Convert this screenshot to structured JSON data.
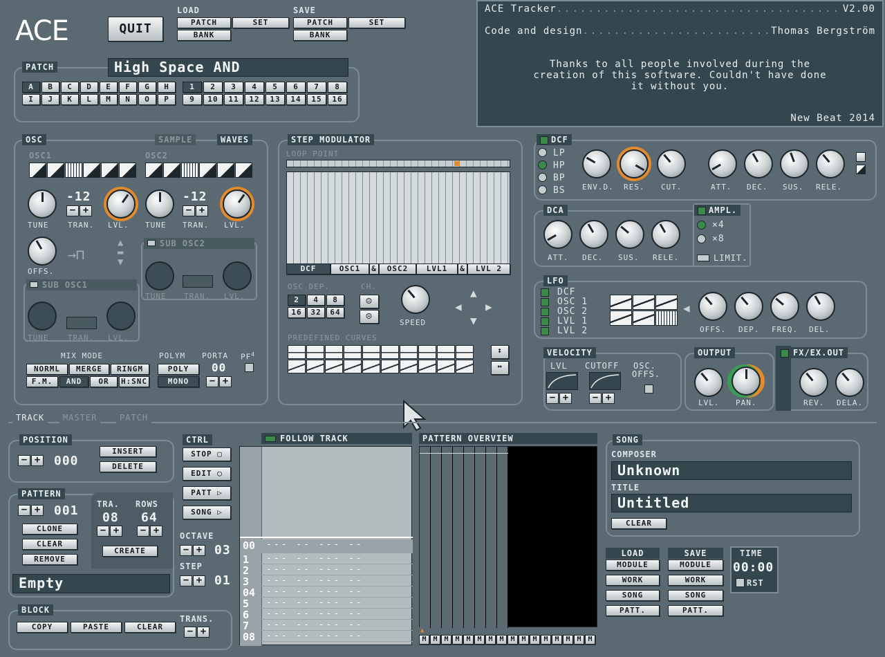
{
  "app": {
    "logo": "ACE",
    "quit": "QUIT"
  },
  "load": {
    "title": "LOAD",
    "patch": "PATCH",
    "set": "SET",
    "bank": "BANK"
  },
  "save": {
    "title": "SAVE",
    "patch": "PATCH",
    "set": "SET",
    "bank": "BANK"
  },
  "info": {
    "line1_left": "ACE Tracker",
    "line1_right": "V2.00",
    "line2_left": "Code and design",
    "line2_right": "Thomas Bergström",
    "thanks1": "Thanks to all people involved during the",
    "thanks2": "creation of this software. Couldn't have done",
    "thanks3": "it without you.",
    "footer": "New Beat 2014"
  },
  "patch": {
    "title": "PATCH",
    "name": "High Space AND",
    "letters": [
      "A",
      "B",
      "C",
      "D",
      "E",
      "F",
      "G",
      "H",
      "I",
      "J",
      "K",
      "L",
      "M",
      "N",
      "O",
      "P"
    ],
    "numbers": [
      "1",
      "2",
      "3",
      "4",
      "5",
      "6",
      "7",
      "8",
      "9",
      "10",
      "11",
      "12",
      "13",
      "14",
      "15",
      "16"
    ]
  },
  "osc": {
    "title": "OSC",
    "tab_sample": "SAMPLE",
    "tab_waves": "WAVES",
    "osc1": "OSC1",
    "osc2": "OSC2",
    "tune": "TUNE",
    "tran": "TRAN.",
    "lvl": "LVL.",
    "tran1": "-12",
    "tran2": "-12",
    "offs": "OFFS.",
    "sub1": "SUB OSC1",
    "sub2": "SUB OSC2",
    "mix_title": "MIX MODE",
    "mix": [
      "NORML",
      "MERGE",
      "RINGM",
      "F.M.",
      "AND",
      "OR",
      "H:SNC"
    ],
    "polym": "POLYM",
    "poly": "POLY",
    "mono": "MONO",
    "porta": "PORTA",
    "porta_val": "00",
    "pf": "PF",
    "pf_sup": "4"
  },
  "stepmod": {
    "title": "STEP MODULATOR",
    "loop": "LOOP POINT",
    "targets": [
      "DCF",
      "OSC1",
      "&",
      "OSC2",
      "LVL1",
      "&",
      "LVL 2"
    ],
    "oscdep": "OSC DEP.",
    "ch": "CH.",
    "speed": "SPEED",
    "dep": [
      "2",
      "4",
      "8",
      "16",
      "32",
      "64"
    ],
    "curves": "PREDEFINED CURVES"
  },
  "dcf": {
    "title": "DCF",
    "modes": [
      "LP",
      "HP",
      "BP",
      "BS"
    ],
    "knobs": [
      "ENV.D.",
      "RES.",
      "CUT.",
      "ATT.",
      "DEC.",
      "SUS.",
      "RELE."
    ]
  },
  "dca": {
    "title": "DCA",
    "knobs": [
      "ATT.",
      "DEC.",
      "SUS.",
      "RELE."
    ],
    "ampl": "AMPL.",
    "x4": "×4",
    "x8": "×8",
    "limit": "LIMIT."
  },
  "lfo": {
    "title": "LFO",
    "targets": [
      "DCF",
      "OSC 1",
      "OSC 2",
      "LVL 1",
      "LVL 2"
    ],
    "knobs": [
      "OFFS.",
      "DEP.",
      "FREQ.",
      "DEL."
    ]
  },
  "velocity": {
    "title": "VELOCITY",
    "lvl": "LVL",
    "cutoff": "CUTOFF",
    "osc": "OSC.",
    "offs": "OFFS."
  },
  "output": {
    "title": "OUTPUT",
    "lvl": "LVL.",
    "pan": "PAN."
  },
  "fx": {
    "title": "FX/EX.OUT",
    "rev": "REV.",
    "dela": "DELA."
  },
  "tabs": {
    "track": "TRACK",
    "master": "MASTER",
    "patch": "PATCH"
  },
  "position": {
    "title": "POSITION",
    "value": "000",
    "insert": "INSERT",
    "delete": "DELETE"
  },
  "pattern": {
    "title": "PATTERN",
    "value": "001",
    "clone": "CLONE",
    "clear": "CLEAR",
    "remove": "REMOVE",
    "tra": "TRA.",
    "tra_val": "08",
    "rows": "ROWS",
    "rows_val": "64",
    "create": "CREATE",
    "name": "Empty"
  },
  "block": {
    "title": "BLOCK",
    "copy": "COPY",
    "paste": "PASTE",
    "clear": "CLEAR",
    "trans": "TRANS."
  },
  "ctrl": {
    "title": "CTRL",
    "stop": "STOP",
    "edit": "EDIT",
    "patt": "PATT",
    "song": "SONG",
    "octave": "OCTAVE",
    "octave_val": "03",
    "step": "STEP",
    "step_val": "01"
  },
  "follow": {
    "title": "FOLLOW TRACK",
    "rows": [
      {
        "n": "00",
        "t": "--- -- --- --"
      },
      {
        "n": "1",
        "t": "--- -- --- --"
      },
      {
        "n": "2",
        "t": "--- -- --- --"
      },
      {
        "n": "3",
        "t": "--- -- --- --"
      },
      {
        "n": "04",
        "t": "--- -- --- --"
      },
      {
        "n": "5",
        "t": "--- -- --- --"
      },
      {
        "n": "6",
        "t": "--- -- --- --"
      },
      {
        "n": "7",
        "t": "--- -- --- --"
      },
      {
        "n": "08",
        "t": "--- -- --- --"
      }
    ]
  },
  "overview": {
    "title": "PATTERN OVERVIEW",
    "m": "M"
  },
  "song": {
    "title": "SONG",
    "composer_label": "COMPOSER",
    "composer": "Unknown",
    "title_label": "TITLE",
    "title_val": "Untitled",
    "clear": "CLEAR"
  },
  "files": {
    "load": "LOAD",
    "save": "SAVE",
    "module": "MODULE",
    "work": "WORK",
    "song": "SONG",
    "patt": "PATT."
  },
  "time": {
    "title": "TIME",
    "value": "00:00",
    "rst": "RST"
  }
}
